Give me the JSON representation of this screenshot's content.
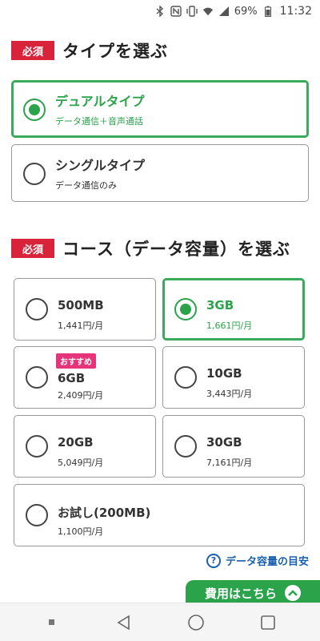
{
  "status_bar": {
    "battery": "69%",
    "time": "11:32",
    "icons": [
      "bluetooth-icon",
      "nfc-icon",
      "vibrate-icon",
      "wifi-icon",
      "signal-icon",
      "battery-icon"
    ]
  },
  "type_section": {
    "badge": "必須",
    "title": "タイプを選ぶ",
    "options": [
      {
        "title": "デュアルタイプ",
        "subtitle": "データ通信＋音声通話",
        "selected": true
      },
      {
        "title": "シングルタイプ",
        "subtitle": "データ通信のみ",
        "selected": false
      }
    ]
  },
  "course_section": {
    "badge": "必須",
    "title": "コース（データ容量）を選ぶ",
    "options": [
      {
        "name": "500MB",
        "price": "1,441円/月",
        "selected": false
      },
      {
        "name": "3GB",
        "price": "1,661円/月",
        "selected": true
      },
      {
        "name": "6GB",
        "price": "2,409円/月",
        "selected": false,
        "tag": "おすすめ"
      },
      {
        "name": "10GB",
        "price": "3,443円/月",
        "selected": false
      },
      {
        "name": "20GB",
        "price": "5,049円/月",
        "selected": false
      },
      {
        "name": "30GB",
        "price": "7,161円/月",
        "selected": false
      },
      {
        "name": "お試し(200MB)",
        "price": "1,100円/月",
        "selected": false
      }
    ]
  },
  "guide_link": {
    "label": "データ容量の目安"
  },
  "cost_button": {
    "label": "費用はこちら"
  },
  "colors": {
    "accent": "#2aa34a",
    "required": "#d9233a",
    "tag": "#e6347a",
    "link": "#1a5fb0"
  }
}
